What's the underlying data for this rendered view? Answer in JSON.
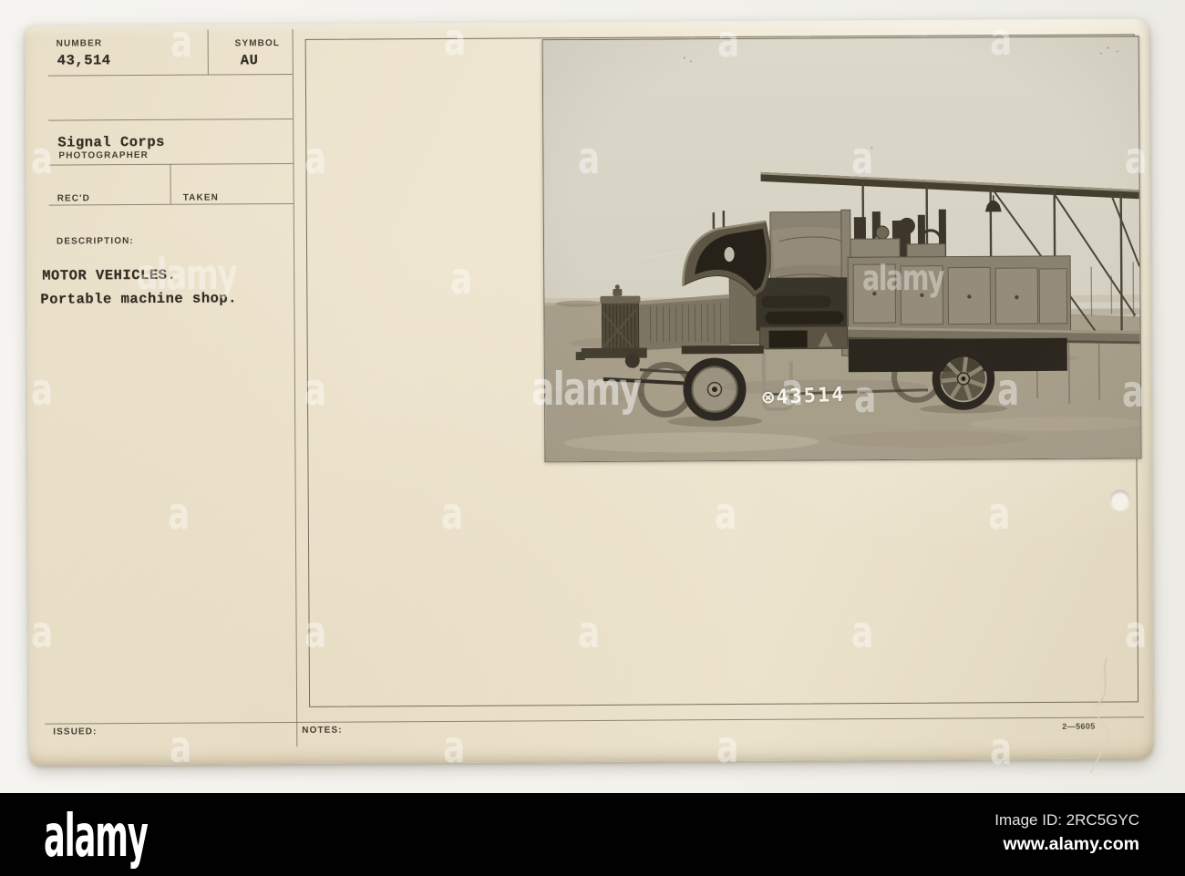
{
  "card": {
    "color": "#ebe2cc",
    "number_label": "NUMBER",
    "number_value": "43,514",
    "symbol_label": "SYMBOL",
    "symbol_value": "AU",
    "photographer_value": "Signal Corps",
    "photographer_label": "PHOTOGRAPHER",
    "received_label": "REC'D",
    "taken_label": "TAKEN",
    "description_label": "DESCRIPTION:",
    "description_line1": "MOTOR VEHICLES.",
    "description_line2": "Portable machine shop.",
    "issued_label": "ISSUED:",
    "notes_label": "NOTES:",
    "print_code": "2—5605"
  },
  "photo": {
    "stamp": "⊗43514",
    "sky_color": "#d6d2c4",
    "ground_color": "#a89f8b",
    "subject": "Portable machine shop truck"
  },
  "watermark": {
    "letter": "a",
    "word": "alamy"
  },
  "footer": {
    "bar_color": "#010101",
    "logo": "alamy",
    "image_id": "Image ID: 2RC5GYC",
    "url": "www.alamy.com"
  }
}
